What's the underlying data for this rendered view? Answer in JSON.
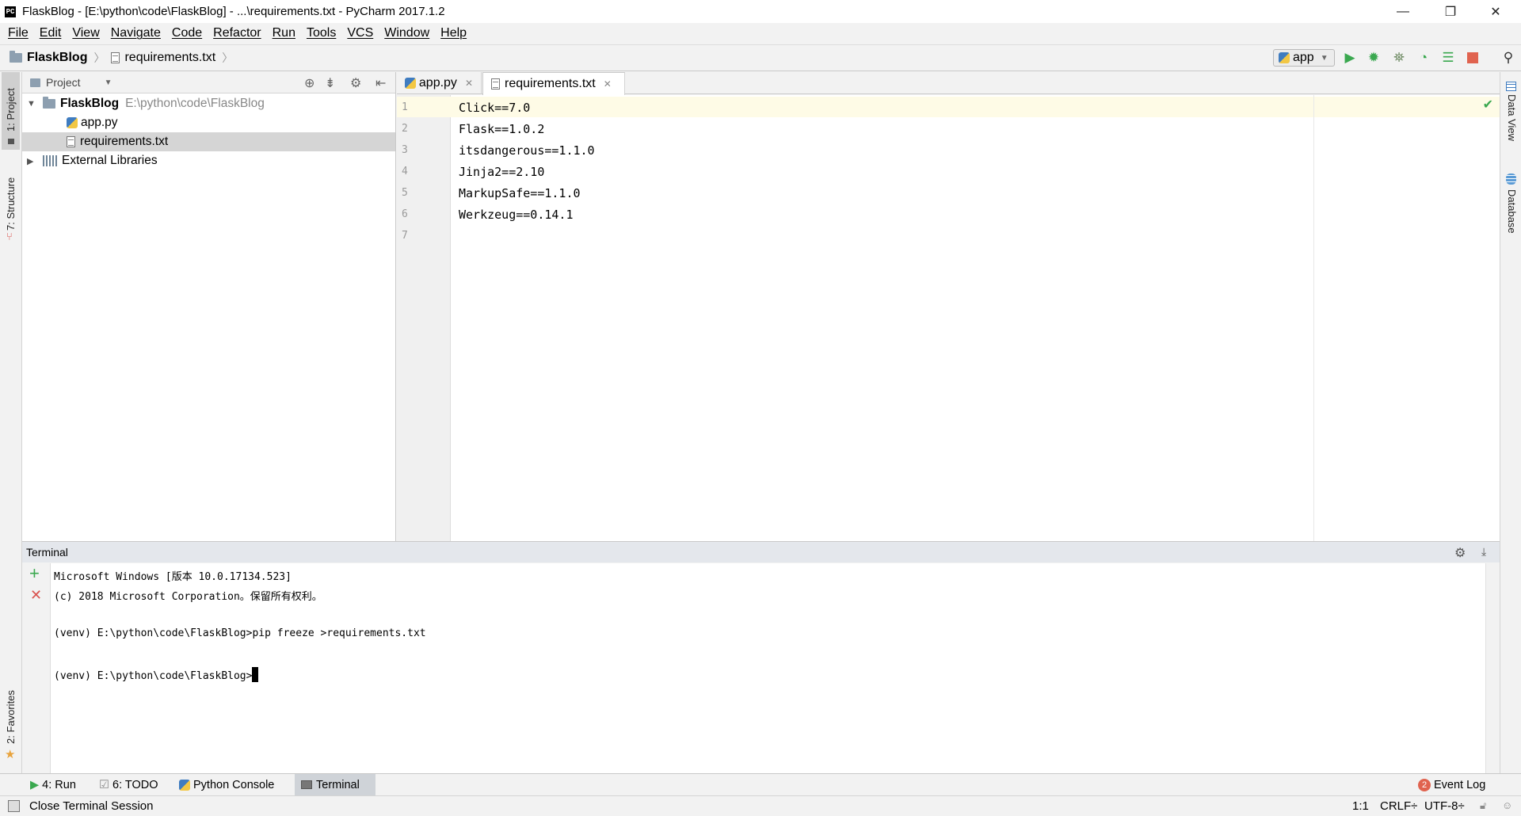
{
  "window": {
    "title": "FlaskBlog - [E:\\python\\code\\FlaskBlog] - ...\\requirements.txt - PyCharm 2017.1.2",
    "app_icon_text": "PC",
    "minimize": "—",
    "restore": "❐",
    "close": "✕"
  },
  "menu": [
    "File",
    "Edit",
    "View",
    "Navigate",
    "Code",
    "Refactor",
    "Run",
    "Tools",
    "VCS",
    "Window",
    "Help"
  ],
  "navbar": {
    "crumbs": [
      "FlaskBlog",
      "requirements.txt"
    ],
    "run_config": "app",
    "toolbar_icons": [
      "run-icon",
      "debug-icon",
      "coverage-icon",
      "profile-icon",
      "concurrency-icon",
      "stop-icon",
      "search-icon"
    ]
  },
  "left_strip": {
    "project_tab": "1: Project",
    "structure_tab": "7: Structure",
    "favorites_tab": "2: Favorites"
  },
  "right_strip": {
    "dataview_tab": "Data View",
    "database_tab": "Database"
  },
  "project": {
    "header": "Project",
    "root": {
      "name": "FlaskBlog",
      "path": "E:\\python\\code\\FlaskBlog"
    },
    "files": [
      "app.py",
      "requirements.txt"
    ],
    "external": "External Libraries"
  },
  "editor": {
    "tabs": [
      {
        "label": "app.py",
        "active": false
      },
      {
        "label": "requirements.txt",
        "active": true
      }
    ],
    "lines": [
      {
        "num": "1",
        "text": "Click==7.0"
      },
      {
        "num": "2",
        "text": "Flask==1.0.2"
      },
      {
        "num": "3",
        "text": "itsdangerous==1.1.0"
      },
      {
        "num": "4",
        "text": "Jinja2==2.10"
      },
      {
        "num": "5",
        "text": "MarkupSafe==1.1.0"
      },
      {
        "num": "6",
        "text": "Werkzeug==0.14.1"
      },
      {
        "num": "7",
        "text": ""
      }
    ]
  },
  "terminal": {
    "title": "Terminal",
    "lines": [
      "Microsoft Windows [版本 10.0.17134.523]",
      "(c) 2018 Microsoft Corporation。保留所有权利。",
      "",
      "(venv) E:\\python\\code\\FlaskBlog>pip freeze >requirements.txt",
      "",
      "(venv) E:\\python\\code\\FlaskBlog>"
    ]
  },
  "bottom_tabs": [
    {
      "label": "4: Run",
      "icon": "run-icon"
    },
    {
      "label": "6: TODO",
      "icon": "todo-icon"
    },
    {
      "label": "Python Console",
      "icon": "python-icon"
    },
    {
      "label": "Terminal",
      "icon": "terminal-icon",
      "active": true
    }
  ],
  "event_log": {
    "label": "Event Log",
    "count": "2"
  },
  "status": {
    "message": "Close Terminal Session",
    "position": "1:1",
    "line_sep": "CRLF÷",
    "encoding": "UTF-8÷"
  },
  "colors": {
    "run_green": "#3aa84f",
    "stop_red": "#e0634f",
    "accent_blue": "#3f7cc0"
  }
}
